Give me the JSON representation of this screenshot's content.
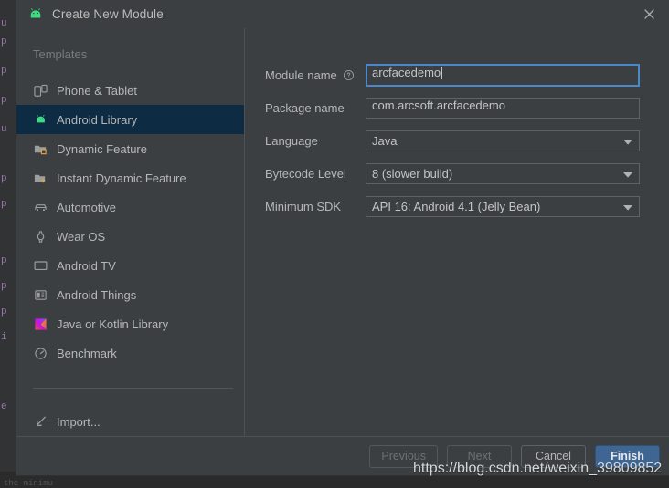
{
  "window": {
    "title": "Create New Module",
    "title_icon": "android-robot-icon",
    "close_icon": "close-icon"
  },
  "sidebar": {
    "header": "Templates",
    "items": [
      {
        "label": "Phone & Tablet",
        "icon": "phone-tablet-icon",
        "selected": false
      },
      {
        "label": "Android Library",
        "icon": "android-robot-icon",
        "selected": true
      },
      {
        "label": "Dynamic Feature",
        "icon": "folder-module-icon",
        "selected": false
      },
      {
        "label": "Instant Dynamic Feature",
        "icon": "folder-lightning-icon",
        "selected": false
      },
      {
        "label": "Automotive",
        "icon": "car-icon",
        "selected": false
      },
      {
        "label": "Wear OS",
        "icon": "watch-icon",
        "selected": false
      },
      {
        "label": "Android TV",
        "icon": "tv-icon",
        "selected": false
      },
      {
        "label": "Android Things",
        "icon": "chip-icon",
        "selected": false
      },
      {
        "label": "Java or Kotlin Library",
        "icon": "kotlin-icon",
        "selected": false
      },
      {
        "label": "Benchmark",
        "icon": "gauge-icon",
        "selected": false
      }
    ],
    "import_item": {
      "label": "Import...",
      "icon": "import-arrow-icon"
    }
  },
  "form": {
    "module_name": {
      "label": "Module name",
      "value": "arcfacedemo",
      "help_icon": "help-circle-icon",
      "focused": true
    },
    "package_name": {
      "label": "Package name",
      "value": "com.arcsoft.arcfacedemo"
    },
    "language": {
      "label": "Language",
      "value": "Java",
      "dropdown_icon": "chevron-down-icon"
    },
    "bytecode_level": {
      "label": "Bytecode Level",
      "value": "8 (slower build)",
      "dropdown_icon": "chevron-down-icon"
    },
    "minimum_sdk": {
      "label": "Minimum SDK",
      "value": "API 16: Android 4.1 (Jelly Bean)",
      "dropdown_icon": "chevron-down-icon"
    }
  },
  "buttons": {
    "previous": {
      "label": "Previous",
      "disabled": true
    },
    "next": {
      "label": "Next",
      "disabled": true
    },
    "cancel": {
      "label": "Cancel",
      "disabled": false
    },
    "finish": {
      "label": "Finish",
      "disabled": false,
      "primary": true
    }
  },
  "watermark": "https://blog.csdn.net/weixin_39809852",
  "background": {
    "gutter_glyphs": [
      "u",
      "p",
      "p",
      "p",
      "u",
      "p",
      "p",
      "p",
      "p",
      "p",
      "i",
      "e"
    ],
    "bottom_text": "the minimu"
  },
  "colors": {
    "dialog_bg": "#3c3f41",
    "selection_bg": "#0d2b43",
    "focus_border": "#4a88c7",
    "primary_button": "#3f6593",
    "android_green": "#3ddc84",
    "text": "#b5b7b8"
  }
}
